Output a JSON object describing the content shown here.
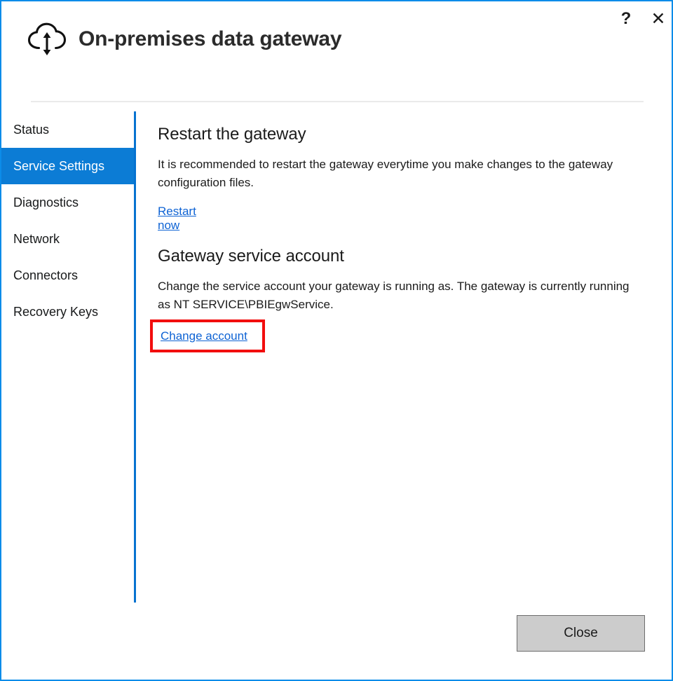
{
  "window": {
    "title": "On-premises data gateway",
    "logo_icon": "cloud-upload-download-icon",
    "border_color": "#0c8ce9",
    "help_label": "?",
    "close_label": "✕"
  },
  "sidebar": {
    "selected_index": 1,
    "accent_color": "#0c7cd5",
    "items": [
      {
        "label": "Status"
      },
      {
        "label": "Service Settings"
      },
      {
        "label": "Diagnostics"
      },
      {
        "label": "Network"
      },
      {
        "label": "Connectors"
      },
      {
        "label": "Recovery Keys"
      }
    ]
  },
  "main": {
    "restart_section": {
      "heading": "Restart the gateway",
      "body": "It is recommended to restart the gateway everytime you make changes to the gateway configuration files.",
      "link_label": "Restart now"
    },
    "account_section": {
      "heading": "Gateway service account",
      "body": "Change the service account your gateway is running as. The gateway is currently running as NT SERVICE\\PBIEgwService.",
      "link_label": "Change account",
      "highlight_color": "#f20d0d"
    }
  },
  "footer": {
    "close_label": "Close"
  }
}
